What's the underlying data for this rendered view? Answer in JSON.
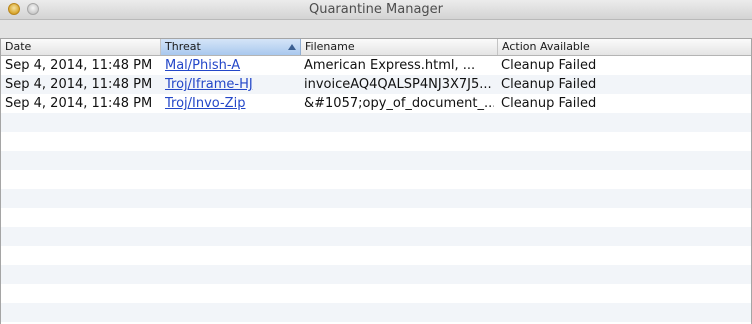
{
  "window": {
    "title": "Quarantine Manager"
  },
  "table": {
    "columns": [
      "Date",
      "Threat",
      "Filename",
      "Action Available"
    ],
    "sorted_column": "Threat",
    "rows": [
      {
        "date": "Sep 4, 2014, 11:48 PM",
        "threat": "Mal/Phish-A",
        "filename": "American Express.html, ...",
        "action": "Cleanup Failed"
      },
      {
        "date": "Sep 4, 2014, 11:48 PM",
        "threat": "Troj/Iframe-HJ",
        "filename": "invoiceAQ4QALSP4NJ3X7J5...",
        "action": "Cleanup Failed"
      },
      {
        "date": "Sep 4, 2014, 11:48 PM",
        "threat": "Troj/Invo-Zip",
        "filename": "&#1057;opy_of_document_...",
        "action": "Cleanup Failed"
      }
    ]
  },
  "colors": {
    "link": "#2447c8",
    "sorted_header": "#a9c8ee",
    "stripe": "#f2f5f9"
  }
}
